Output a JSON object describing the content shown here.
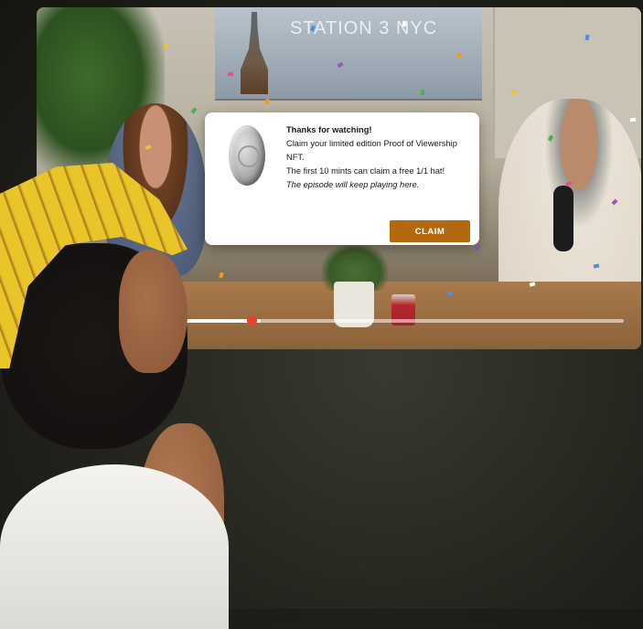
{
  "video": {
    "sign_text": "STATION 3 NYC"
  },
  "modal": {
    "title": "Thanks for watching!",
    "line1": "Claim your limited edition Proof of Viewership NFT.",
    "line2": "The first 10 mints can claim a free 1/1 hat!",
    "note": "The episode will keep playing here.",
    "claim_label": "CLAIM",
    "icon": "nft-coin-icon"
  },
  "player": {
    "progress_fraction": 0.19,
    "progress_color": "#ffffff",
    "scrubber_color": "#e8422b"
  },
  "colors": {
    "claim_button": "#b36a0e",
    "hat": "#e8c62a"
  }
}
